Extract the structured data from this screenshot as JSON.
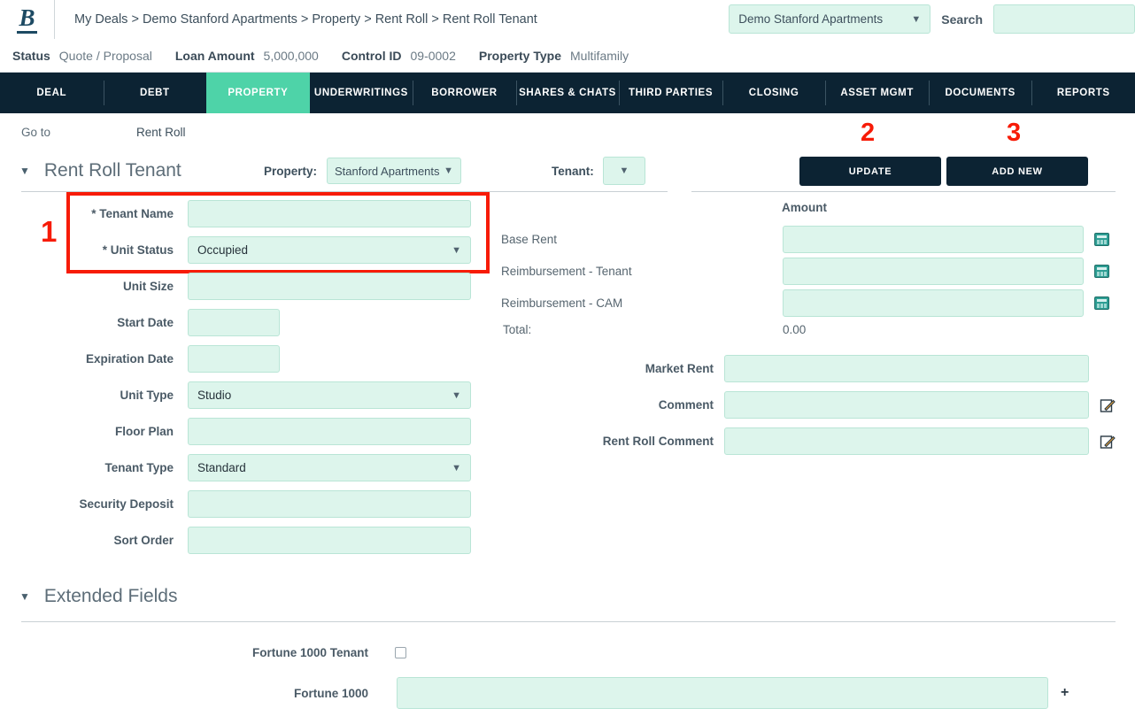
{
  "header": {
    "logo": "B",
    "breadcrumb": "My Deals > Demo Stanford Apartments > Property > Rent Roll > Rent Roll Tenant",
    "deal_select_value": "Demo Stanford Apartments",
    "search_label": "Search",
    "search_value": ""
  },
  "status": {
    "status_key": "Status",
    "status_value": "Quote / Proposal",
    "loan_key": "Loan Amount",
    "loan_value": "5,000,000",
    "control_key": "Control ID",
    "control_value": "09-0002",
    "proptype_key": "Property Type",
    "proptype_value": "Multifamily"
  },
  "nav": {
    "items": [
      {
        "label": "DEAL",
        "active": false
      },
      {
        "label": "DEBT",
        "active": false
      },
      {
        "label": "PROPERTY",
        "active": true
      },
      {
        "label": "UNDERWRITINGS",
        "active": false
      },
      {
        "label": "BORROWER",
        "active": false
      },
      {
        "label": "SHARES & CHATS",
        "active": false
      },
      {
        "label": "THIRD PARTIES",
        "active": false
      },
      {
        "label": "CLOSING",
        "active": false
      },
      {
        "label": "ASSET MGMT",
        "active": false
      },
      {
        "label": "DOCUMENTS",
        "active": false
      },
      {
        "label": "REPORTS",
        "active": false
      }
    ]
  },
  "goto": {
    "label": "Go to",
    "link": "Rent Roll"
  },
  "section": {
    "title": "Rent Roll Tenant",
    "property_label": "Property:",
    "property_value": "Stanford Apartments",
    "tenant_label": "Tenant:",
    "tenant_value": "",
    "update_button": "UPDATE",
    "addnew_button": "ADD NEW"
  },
  "annotations": {
    "one": "1",
    "two": "2",
    "three": "3",
    "color": "#f71b07"
  },
  "left_form": {
    "tenant_name_label": "* Tenant Name",
    "tenant_name_value": "",
    "unit_status_label": "* Unit Status",
    "unit_status_value": "Occupied",
    "unit_size_label": "Unit Size",
    "unit_size_value": "",
    "start_date_label": "Start Date",
    "start_date_value": "",
    "expiration_date_label": "Expiration Date",
    "expiration_date_value": "",
    "unit_type_label": "Unit Type",
    "unit_type_value": "Studio",
    "floor_plan_label": "Floor Plan",
    "floor_plan_value": "",
    "tenant_type_label": "Tenant Type",
    "tenant_type_value": "Standard",
    "security_deposit_label": "Security Deposit",
    "security_deposit_value": "",
    "sort_order_label": "Sort Order",
    "sort_order_value": ""
  },
  "right_form": {
    "amount_header": "Amount",
    "base_rent_label": "Base Rent",
    "base_rent_value": "",
    "reimb_tenant_label": "Reimbursement - Tenant",
    "reimb_tenant_value": "",
    "reimb_cam_label": "Reimbursement - CAM",
    "reimb_cam_value": "",
    "total_label": "Total:",
    "total_value": "0.00",
    "market_rent_label": "Market Rent",
    "market_rent_value": "",
    "comment_label": "Comment",
    "comment_value": "",
    "rent_roll_comment_label": "Rent Roll Comment",
    "rent_roll_comment_value": ""
  },
  "extended": {
    "title": "Extended Fields",
    "fortune_tenant_label": "Fortune 1000 Tenant",
    "fortune_tenant_checked": false,
    "fortune_label": "Fortune 1000",
    "fortune_value": "",
    "add_symbol": "+"
  },
  "colors": {
    "nav_bg": "#0c2333",
    "nav_active": "#4ed3a8",
    "input_bg": "#ddf5ec",
    "input_border": "#b9e5d6",
    "accent_red": "#f71b07",
    "logo": "#1d4a63"
  }
}
